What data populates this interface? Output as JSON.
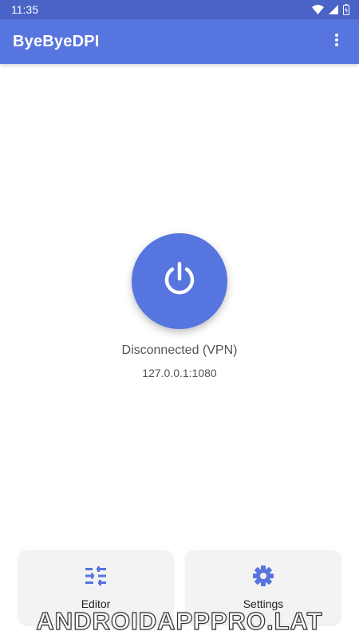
{
  "status_bar": {
    "time": "11:35",
    "icons": [
      "wifi-icon",
      "cell-signal-icon",
      "battery-icon"
    ]
  },
  "app_bar": {
    "title": "ByeByeDPI",
    "menu_icon": "more-vert-icon"
  },
  "main": {
    "power_icon": "power-icon",
    "status": "Disconnected (VPN)",
    "address": "127.0.0.1:1080"
  },
  "bottom_cards": {
    "editor": {
      "label": "Editor",
      "icon": "tune-sliders-icon"
    },
    "settings": {
      "label": "Settings",
      "icon": "gear-icon"
    }
  },
  "watermark": "ANDROIDAPPPRO.LAT",
  "colors": {
    "primary": "#5775de",
    "primary_dark": "#4a63c7",
    "card_background": "#f3f3f3",
    "text_secondary": "#555555"
  }
}
